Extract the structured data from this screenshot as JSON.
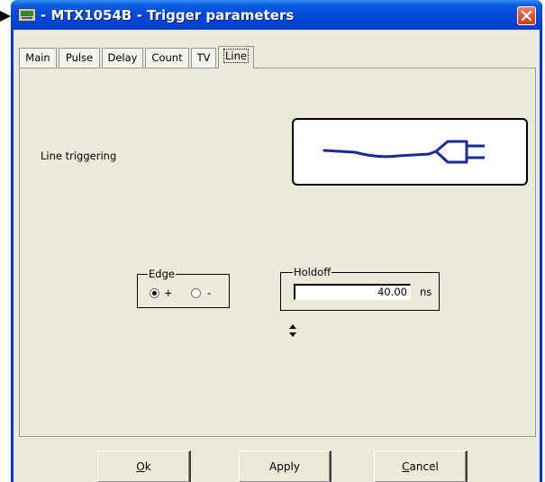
{
  "window": {
    "title": "- MTX1054B - Trigger parameters",
    "icons": {
      "app": "oscilloscope-app-icon",
      "close": "close-icon",
      "pointer": "arrow-pointer-icon",
      "plug": "power-plug-icon"
    },
    "colors": {
      "titlebar": "#0048d8",
      "client": "#ece9d8",
      "close": "#d6512e",
      "plug_stroke": "#1a2a99"
    }
  },
  "tabs": [
    {
      "label": "Main",
      "active": false
    },
    {
      "label": "Pulse",
      "active": false
    },
    {
      "label": "Delay",
      "active": false
    },
    {
      "label": "Count",
      "active": false
    },
    {
      "label": "TV",
      "active": false
    },
    {
      "label": "Line",
      "active": true
    }
  ],
  "line_tab": {
    "description": "Line triggering",
    "edge": {
      "label": "Edge",
      "options": [
        "+",
        "-"
      ],
      "selected": "+"
    },
    "holdoff": {
      "label": "Holdoff",
      "value": "40.00",
      "unit": "ns"
    }
  },
  "buttons": {
    "ok": {
      "first": "O",
      "rest": "k"
    },
    "apply": "Apply",
    "cancel": {
      "first": "C",
      "rest": "ancel"
    }
  }
}
